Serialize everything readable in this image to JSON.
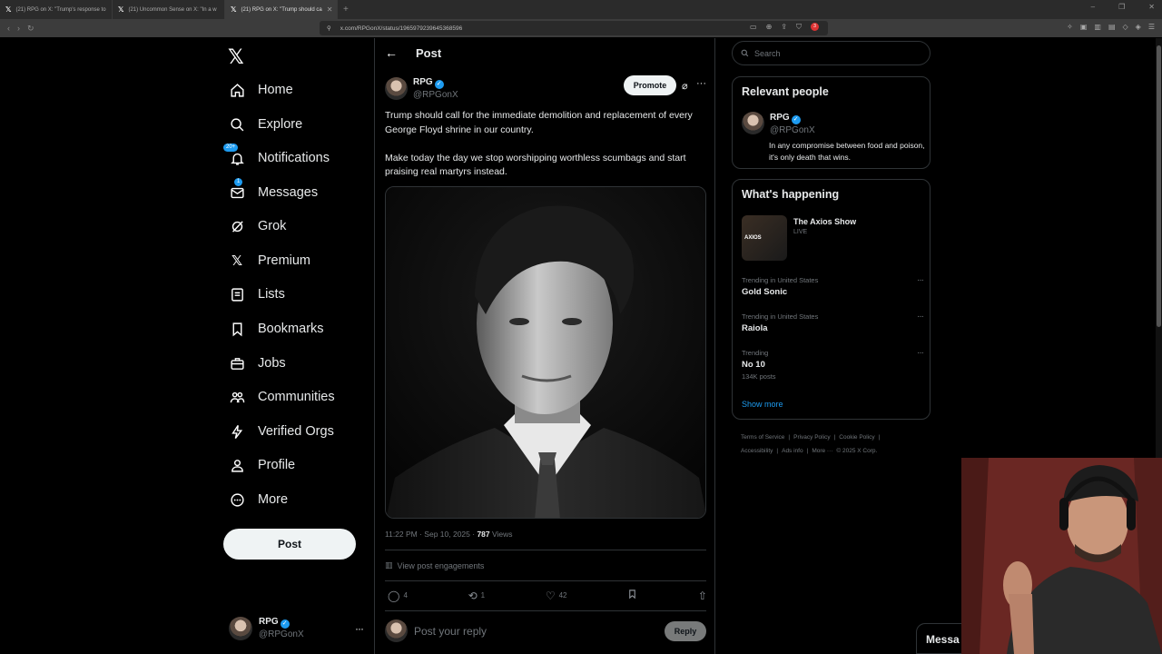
{
  "browser": {
    "tabs": [
      {
        "title": "(21) RPG on X: \"Trump's response to"
      },
      {
        "title": "(21) Uncommon Sense on X: \"In a w"
      },
      {
        "title": "(21) RPG on X: \"Trump should ca"
      }
    ],
    "url": "x.com/RPGonX/status/1965979239645368596",
    "ext_badge": "3"
  },
  "nav": {
    "items": [
      {
        "key": "home",
        "label": "Home",
        "icon": "home-icon"
      },
      {
        "key": "explore",
        "label": "Explore",
        "icon": "search-icon"
      },
      {
        "key": "notifications",
        "label": "Notifications",
        "icon": "bell-icon",
        "badge": "20+"
      },
      {
        "key": "messages",
        "label": "Messages",
        "icon": "mail-icon",
        "badge": "1"
      },
      {
        "key": "grok",
        "label": "Grok",
        "icon": "grok-icon"
      },
      {
        "key": "premium",
        "label": "Premium",
        "icon": "x-logo-icon"
      },
      {
        "key": "lists",
        "label": "Lists",
        "icon": "list-icon"
      },
      {
        "key": "bookmarks",
        "label": "Bookmarks",
        "icon": "bookmark-icon"
      },
      {
        "key": "jobs",
        "label": "Jobs",
        "icon": "briefcase-icon"
      },
      {
        "key": "communities",
        "label": "Communities",
        "icon": "people-icon"
      },
      {
        "key": "verified-orgs",
        "label": "Verified Orgs",
        "icon": "lightning-icon"
      },
      {
        "key": "profile",
        "label": "Profile",
        "icon": "person-icon"
      },
      {
        "key": "more",
        "label": "More",
        "icon": "more-circle-icon"
      }
    ],
    "post_button": "Post",
    "account": {
      "name": "RPG",
      "handle": "@RPGonX"
    }
  },
  "main": {
    "title": "Post",
    "tweet": {
      "name": "RPG",
      "handle": "@RPGonX",
      "promote": "Promote",
      "text1": "Trump should call for the immediate demolition and replacement of every George Floyd shrine in our country.",
      "text2": "Make today the day we stop worshipping worthless scumbags and start praising real martyrs instead.",
      "time": "11:22 PM · Sep 10, 2025 · ",
      "views": "787",
      "views_label": " Views",
      "engagements": "View post engagements",
      "replies": "4",
      "reposts": "1",
      "likes": "42"
    },
    "reply": {
      "placeholder": "Post your reply",
      "button": "Reply"
    }
  },
  "right": {
    "search_placeholder": "Search",
    "relevant": {
      "title": "Relevant people",
      "name": "RPG",
      "handle": "@RPGonX",
      "bio": "In any compromise between food and poison, it's only death that wins."
    },
    "happening": {
      "title": "What's happening",
      "live": {
        "title": "The Axios Show",
        "status": "LIVE",
        "thumb": "AXIOS"
      },
      "trends": [
        {
          "cat": "Trending in United States",
          "name": "Gold Sonic",
          "count": ""
        },
        {
          "cat": "Trending in United States",
          "name": "Raiola",
          "count": ""
        },
        {
          "cat": "Trending",
          "name": "No 10",
          "count": "134K posts"
        }
      ],
      "show_more": "Show more"
    },
    "footer": [
      "Terms of Service",
      "|",
      "Privacy Policy",
      "|",
      "Cookie Policy",
      "|",
      "Accessibility",
      "|",
      "Ads info",
      "|",
      "More ···",
      "© 2025 X Corp."
    ]
  },
  "messages_drawer": "Messa",
  "colors": {
    "accent": "#1d9bf0",
    "bg": "#000000",
    "border": "#2f3336",
    "muted": "#71767b"
  }
}
